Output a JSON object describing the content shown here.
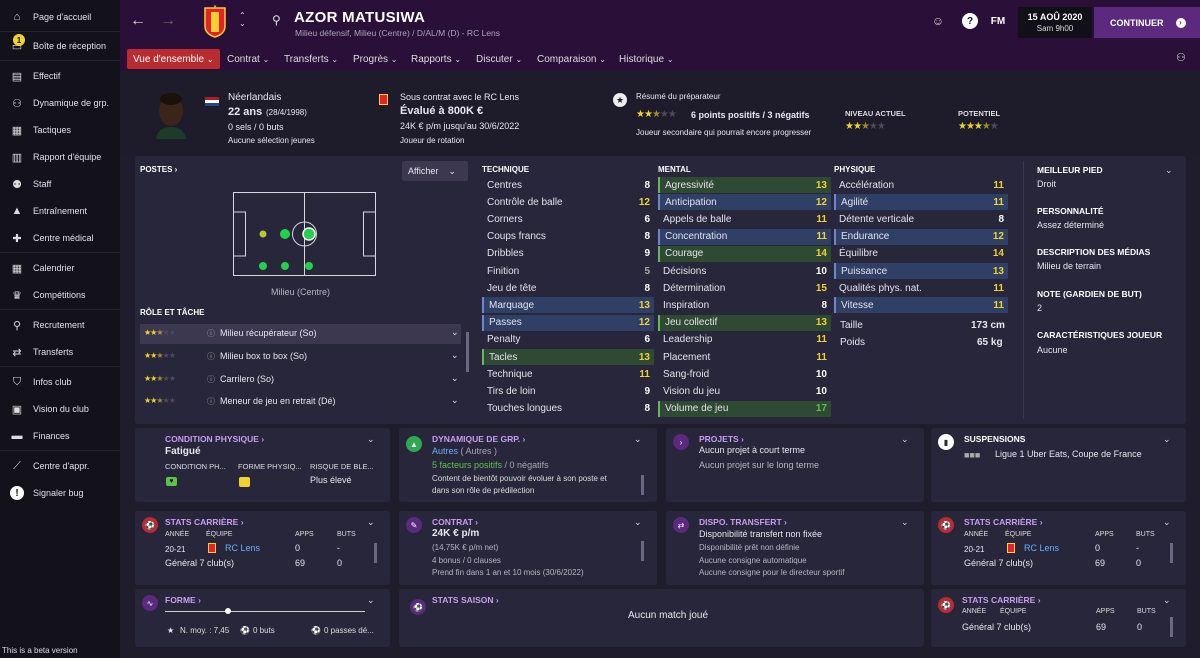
{
  "sidebar": {
    "items": [
      {
        "label": "Page d'accueil",
        "icon": "home-icon"
      },
      {
        "label": "Boîte de réception",
        "icon": "inbox-icon",
        "badge": "1"
      },
      {
        "label": "Effectif",
        "icon": "squad-icon"
      },
      {
        "label": "Dynamique de grp.",
        "icon": "dynamics-icon"
      },
      {
        "label": "Tactiques",
        "icon": "tactics-icon"
      },
      {
        "label": "Rapport d'équipe",
        "icon": "report-icon"
      },
      {
        "label": "Staff",
        "icon": "staff-icon"
      },
      {
        "label": "Entraînement",
        "icon": "training-icon"
      },
      {
        "label": "Centre médical",
        "icon": "medical-icon"
      },
      {
        "label": "Calendrier",
        "icon": "calendar-icon"
      },
      {
        "label": "Compétitions",
        "icon": "trophy-icon"
      },
      {
        "label": "Recrutement",
        "icon": "scouting-icon"
      },
      {
        "label": "Transferts",
        "icon": "transfers-icon"
      },
      {
        "label": "Infos club",
        "icon": "club-info-icon"
      },
      {
        "label": "Vision du club",
        "icon": "club-vision-icon"
      },
      {
        "label": "Finances",
        "icon": "finances-icon"
      },
      {
        "label": "Centre d'appr.",
        "icon": "dev-centre-icon"
      },
      {
        "label": "Signaler bug",
        "icon": "bug-report-icon"
      }
    ],
    "beta_note": "This is a beta version"
  },
  "header": {
    "player_name": "AZOR MATUSIWA",
    "player_sub": "Milieu défensif, Milieu (Centre) / D/AL/M (D) - RC Lens",
    "fm_label": "FM",
    "date": "15 AOÛ 2020",
    "day_time": "Sam 9h00",
    "continue_label": "CONTINUER"
  },
  "tabs": [
    {
      "label": "Vue d'ensemble",
      "active": true
    },
    {
      "label": "Contrat"
    },
    {
      "label": "Transferts"
    },
    {
      "label": "Progrès"
    },
    {
      "label": "Rapports"
    },
    {
      "label": "Discuter"
    },
    {
      "label": "Comparaison"
    },
    {
      "label": "Historique"
    }
  ],
  "summary": {
    "nationality": "Néerlandais",
    "age": "22 ans",
    "dob": "(28/4/1998)",
    "goals": "0 sels / 0 buts",
    "youth": "Aucune sélection jeunes",
    "contract_line": "Sous contrat avec le RC Lens",
    "value": "Évalué à 800K €",
    "wage": "24K € p/m jusqu'au 30/6/2022",
    "role_status": "Joueur de rotation",
    "coach_report_title": "Résumé du préparateur",
    "coach_report_main": "6 points positifs / 3 négatifs",
    "coach_report_sub": "Joueur secondaire qui pourrait encore progresser",
    "current_ability_label": "NIVEAU ACTUEL",
    "potential_label": "POTENTIEL",
    "current_stars": 2.5,
    "potential_stars": 3.5
  },
  "positions": {
    "title": "POSTES",
    "dropdown": "Afficher",
    "position_label": "Milieu (Centre)",
    "role_title": "RÔLE ET TÂCHE",
    "roles": [
      {
        "label": "Milieu récupérateur (So)",
        "stars": 2.5
      },
      {
        "label": "Milieu box to box (So)",
        "stars": 2.5
      },
      {
        "label": "Carrilero (So)",
        "stars": 2.5
      },
      {
        "label": "Meneur de jeu en retrait (Dé)",
        "stars": 2.5
      }
    ]
  },
  "technique": {
    "title": "TECHNIQUE",
    "rows": [
      {
        "label": "Centres",
        "value": "8"
      },
      {
        "label": "Contrôle de balle",
        "value": "12"
      },
      {
        "label": "Corners",
        "value": "6"
      },
      {
        "label": "Coups francs",
        "value": "8"
      },
      {
        "label": "Dribbles",
        "value": "9"
      },
      {
        "label": "Finition",
        "value": "5"
      },
      {
        "label": "Jeu de tête",
        "value": "8"
      },
      {
        "label": "Marquage",
        "value": "13"
      },
      {
        "label": "Passes",
        "value": "12"
      },
      {
        "label": "Penalty",
        "value": "6"
      },
      {
        "label": "Tacles",
        "value": "13"
      },
      {
        "label": "Technique",
        "value": "11"
      },
      {
        "label": "Tirs de loin",
        "value": "9"
      },
      {
        "label": "Touches longues",
        "value": "8"
      }
    ]
  },
  "mental": {
    "title": "MENTAL",
    "rows": [
      {
        "label": "Agressivité",
        "value": "13"
      },
      {
        "label": "Anticipation",
        "value": "12"
      },
      {
        "label": "Appels de balle",
        "value": "11"
      },
      {
        "label": "Concentration",
        "value": "11"
      },
      {
        "label": "Courage",
        "value": "14"
      },
      {
        "label": "Décisions",
        "value": "10"
      },
      {
        "label": "Détermination",
        "value": "15"
      },
      {
        "label": "Inspiration",
        "value": "8"
      },
      {
        "label": "Jeu collectif",
        "value": "13"
      },
      {
        "label": "Leadership",
        "value": "11"
      },
      {
        "label": "Placement",
        "value": "11"
      },
      {
        "label": "Sang-froid",
        "value": "10"
      },
      {
        "label": "Vision du jeu",
        "value": "10"
      },
      {
        "label": "Volume de jeu",
        "value": "17"
      }
    ]
  },
  "physique": {
    "title": "PHYSIQUE",
    "rows": [
      {
        "label": "Accélération",
        "value": "11"
      },
      {
        "label": "Agilité",
        "value": "11"
      },
      {
        "label": "Détente verticale",
        "value": "8"
      },
      {
        "label": "Endurance",
        "value": "12"
      },
      {
        "label": "Équilibre",
        "value": "14"
      },
      {
        "label": "Puissance",
        "value": "13"
      },
      {
        "label": "Qualités phys. nat.",
        "value": "11"
      },
      {
        "label": "Vitesse",
        "value": "11"
      }
    ],
    "height_label": "Taille",
    "height": "173 cm",
    "weight_label": "Poids",
    "weight": "65 kg"
  },
  "info": [
    {
      "title": "MEILLEUR PIED",
      "value": "Droit"
    },
    {
      "title": "PERSONNALITÉ",
      "value": "Assez déterminé"
    },
    {
      "title": "DESCRIPTION DES MÉDIAS",
      "value": "Milieu de terrain"
    },
    {
      "title": "NOTE (GARDIEN DE BUT)",
      "value": "2"
    },
    {
      "title": "CARACTÉRISTIQUES JOUEUR",
      "value": "Aucune"
    }
  ],
  "cards": {
    "condition": {
      "title": "CONDITION PHYSIQUE",
      "value": "Fatigué",
      "c1": "CONDITION PH...",
      "c2": "FORME PHYSIQ...",
      "c3": "RISQUE DE BLE...",
      "risk": "Plus élevé"
    },
    "dynamics": {
      "title": "DYNAMIQUE DE GRP.",
      "line1": "Autres",
      "line1b": "( Autres )",
      "line2a": "5 facteurs positifs",
      "line2b": "/ 0 négatifs",
      "line3": "Content de bientôt pouvoir évoluer à son poste et",
      "line4": "dans son rôle de prédilection"
    },
    "projects": {
      "title": "PROJETS",
      "line1": "Aucun projet à court terme",
      "line2": "Aucun projet sur le long terme"
    },
    "suspensions": {
      "title": "SUSPENSIONS",
      "line1": "Ligue 1 Uber Eats, Coupe de France"
    },
    "career1": {
      "title": "STATS CARRIÈRE",
      "h1": "ANNÉE",
      "h2": "ÉQUIPE",
      "h3": "APPS",
      "h4": "BUTS",
      "year": "20-21",
      "team": "RC Lens",
      "apps": "0",
      "goals": "-",
      "total": "Général 7 club(s)",
      "total_apps": "69",
      "total_goals": "0"
    },
    "contract": {
      "title": "CONTRAT",
      "wage": "24K € p/m",
      "net": "(14,75K € p/m net)",
      "bonus": "4 bonus / 0 clauses",
      "expiry": "Prend fin dans 1 an et 10 mois (30/6/2022)"
    },
    "transfer": {
      "title": "DISPO. TRANSFERT",
      "line1": "Disponibilité transfert non fixée",
      "line2": "Disponibilité prêt non définie",
      "line3": "Aucune consigne automatique",
      "line4": "Aucune consigne pour le directeur sportif"
    },
    "career2": {
      "title": "STATS CARRIÈRE",
      "h1": "ANNÉE",
      "h2": "ÉQUIPE",
      "h3": "APPS",
      "h4": "BUTS",
      "year": "20-21",
      "team": "RC Lens",
      "apps": "0",
      "goals": "-",
      "total": "Général 7 club(s)",
      "total_apps": "69",
      "total_goals": "0"
    },
    "form": {
      "title": "FORME",
      "avg": "N. moy. : 7,45",
      "goals": "0 buts",
      "passes": "0 passes dé..."
    },
    "season": {
      "title": "STATS SAISON",
      "empty": "Aucun match joué"
    },
    "career3": {
      "title": "STATS CARRIÈRE",
      "h1": "ANNÉE",
      "h2": "ÉQUIPE",
      "h3": "APPS",
      "h4": "BUTS",
      "total": "Général 7 club(s)",
      "total_apps": "69",
      "total_goals": "0"
    }
  },
  "colors": {
    "accent": "#b82b2f",
    "header_bg": "#2a0f38",
    "star": "#f2d230",
    "positive": "#5ec24a",
    "highlight_blue": "#2f3f66",
    "highlight_green": "#2f4a32"
  }
}
